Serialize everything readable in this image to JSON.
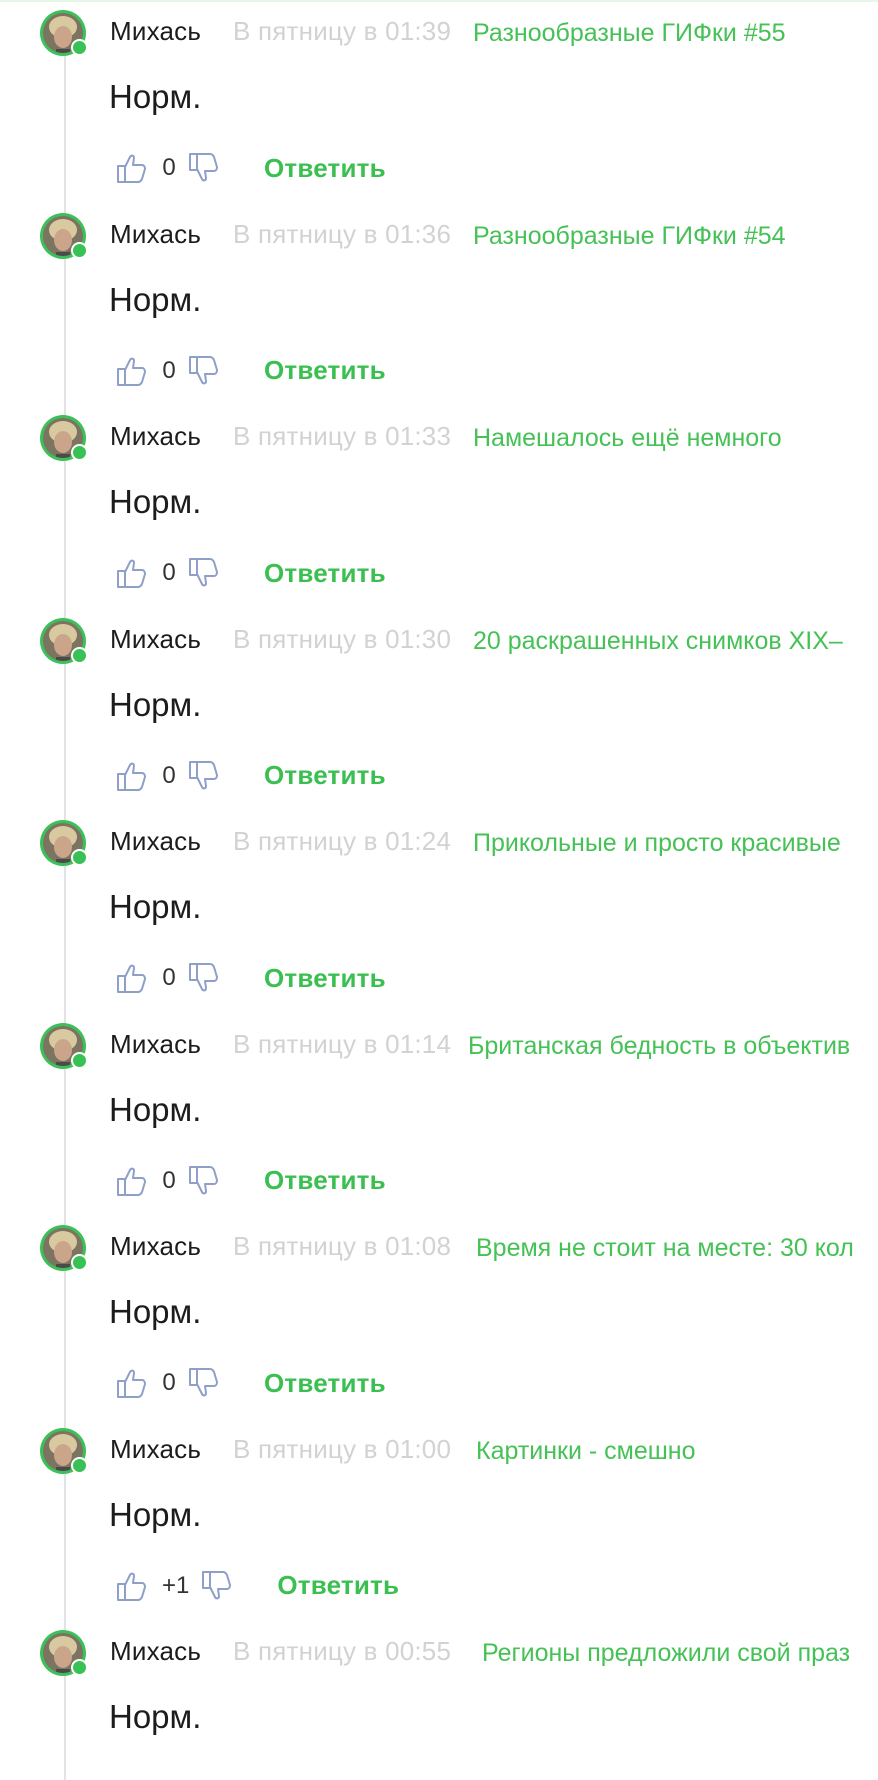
{
  "colors": {
    "accent": "#45c156",
    "time": "#d2d2d2",
    "text": "#1c1c1c",
    "online": "#38c154"
  },
  "icons": {
    "like": "thumbs-up-outline",
    "dislike": "thumbs-down-outline",
    "online": "online-dot"
  },
  "comments": [
    {
      "author": "Михась",
      "time": "В пятницу в 01:39",
      "post": "Разнообразные ГИФки #55",
      "text": "Норм.",
      "score": "0",
      "reply": "Ответить"
    },
    {
      "author": "Михась",
      "time": "В пятницу в 01:36",
      "post": "Разнообразные ГИФки #54",
      "text": "Норм.",
      "score": "0",
      "reply": "Ответить"
    },
    {
      "author": "Михась",
      "time": "В пятницу в 01:33",
      "post": "Намешалось ещё немного",
      "text": "Норм.",
      "score": "0",
      "reply": "Ответить"
    },
    {
      "author": "Михась",
      "time": "В пятницу в 01:30",
      "post": "20 раскрашенных снимков XIX–",
      "text": "Норм.",
      "score": "0",
      "reply": "Ответить"
    },
    {
      "author": "Михась",
      "time": "В пятницу в 01:24",
      "post": "Прикольные и просто красивые",
      "text": "Норм.",
      "score": "0",
      "reply": "Ответить"
    },
    {
      "author": "Михась",
      "time": "В пятницу в 01:14",
      "post": "Британская бедность в объектив",
      "text": "Норм.",
      "score": "0",
      "reply": "Ответить"
    },
    {
      "author": "Михась",
      "time": "В пятницу в 01:08",
      "post": "Время не стоит на месте: 30 кол",
      "text": "Норм.",
      "score": "0",
      "reply": "Ответить"
    },
    {
      "author": "Михась",
      "time": "В пятницу в 01:00",
      "post": "Картинки - смешно",
      "text": "Норм.",
      "score": "+1",
      "reply": "Ответить"
    },
    {
      "author": "Михась",
      "time": "В пятницу в 00:55",
      "post": "Регионы предложили свой праз",
      "text": "Норм.",
      "score": "",
      "reply": ""
    }
  ]
}
